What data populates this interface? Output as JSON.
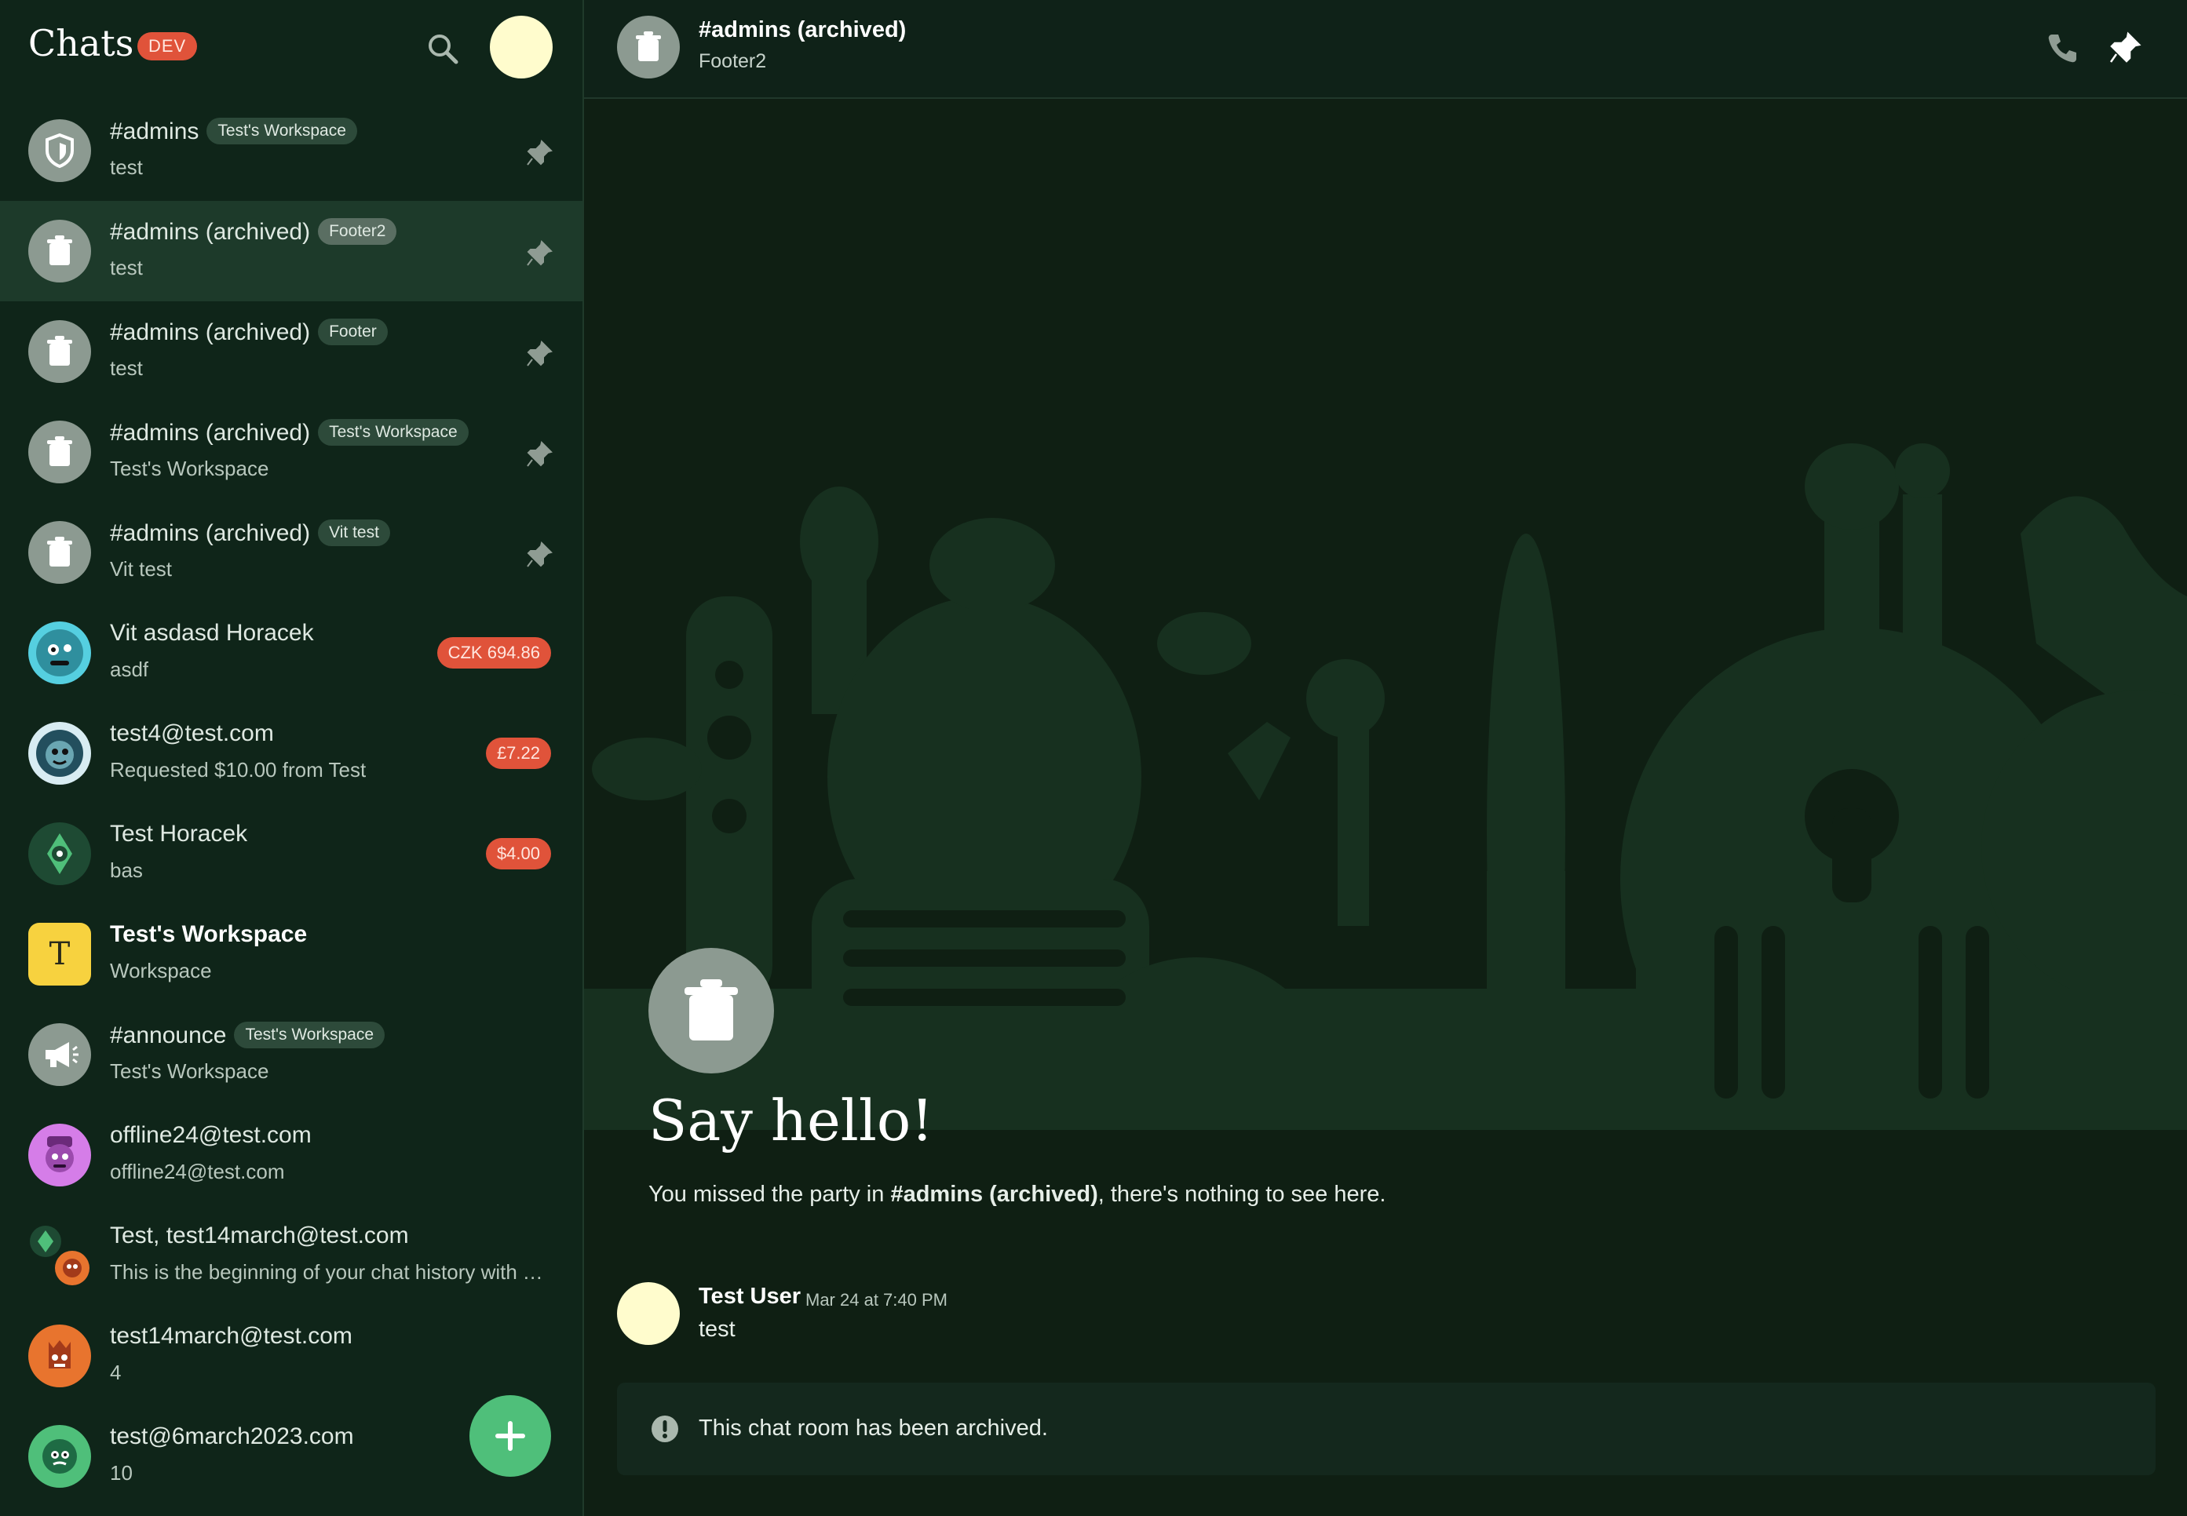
{
  "sidebar": {
    "title": "Chats",
    "badge": "DEV",
    "fab_icon": "plus-icon",
    "chats": [
      {
        "name": "#admins",
        "tag": "Test's Workspace",
        "preview": "test",
        "icon": "shield-icon",
        "pinned": true
      },
      {
        "name": "#admins (archived)",
        "tag": "Footer2",
        "preview": "test",
        "icon": "trash-icon",
        "pinned": true,
        "selected": true
      },
      {
        "name": "#admins (archived)",
        "tag": "Footer",
        "preview": "test",
        "icon": "trash-icon",
        "pinned": true
      },
      {
        "name": "#admins (archived)",
        "tag": "Test's Workspace",
        "preview": "Test's Workspace",
        "icon": "trash-icon",
        "pinned": true
      },
      {
        "name": "#admins (archived)",
        "tag": "Vit test",
        "preview": "Vit test",
        "icon": "trash-icon",
        "pinned": true
      },
      {
        "name": "Vit asdasd Horacek",
        "preview": "asdf",
        "amount": "CZK 694.86",
        "icon": "character-avatar"
      },
      {
        "name": "test4@test.com",
        "preview": "Requested $10.00 from Test",
        "amount": "£7.22",
        "icon": "character-avatar"
      },
      {
        "name": "Test Horacek",
        "preview": "bas",
        "amount": "$4.00",
        "icon": "character-avatar"
      },
      {
        "name": "Test's Workspace",
        "preview": "Workspace",
        "icon": "workspace-avatar",
        "letter": "T"
      },
      {
        "name": "#announce",
        "tag": "Test's Workspace",
        "preview": "Test's Workspace",
        "icon": "megaphone-icon"
      },
      {
        "name": "offline24@test.com",
        "preview": "offline24@test.com",
        "icon": "character-avatar"
      },
      {
        "name": "Test, test14march@test.com",
        "preview": "This is the beginning of your chat history with T...",
        "icon": "group-avatar"
      },
      {
        "name": "test14march@test.com",
        "preview": "4",
        "icon": "character-avatar"
      },
      {
        "name": "test@6march2023.com",
        "preview": "10",
        "icon": "character-avatar"
      }
    ]
  },
  "header": {
    "title": "#admins (archived)",
    "subtitle": "Footer2"
  },
  "hero": {
    "title": "Say hello!",
    "text_before": "You missed the party in ",
    "text_bold": "#admins (archived)",
    "text_after": ", there's nothing to see here."
  },
  "message": {
    "user": "Test User",
    "time": "Mar 24 at 7:40 PM",
    "text": "test"
  },
  "notice": {
    "text": "This chat room has been archived."
  },
  "colors": {
    "accent": "#e0533a",
    "fab": "#4fbf7a",
    "sidebar_bg": "#0f2519",
    "selected_row": "#1d3a2a"
  }
}
